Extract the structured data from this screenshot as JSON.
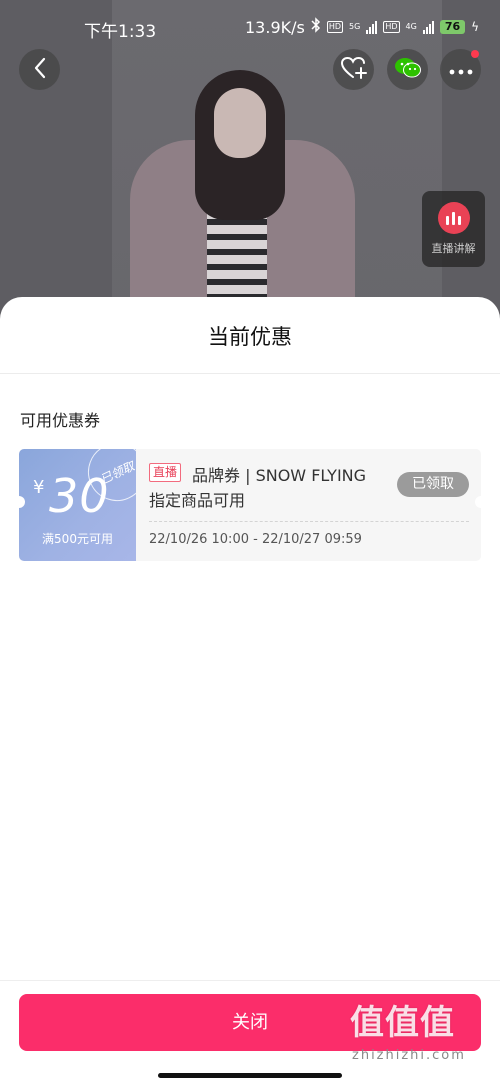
{
  "status_bar": {
    "time": "下午1:33",
    "network_speed": "13.9K/s",
    "sim1_type": "5G",
    "sim2_type": "4G",
    "hd_label": "HD",
    "battery": "76"
  },
  "top_actions": {
    "back_icon": "chevron-left-icon",
    "favorite_icon": "heart-plus-icon",
    "wechat_icon": "wechat-icon",
    "more_icon": "more-dots-icon"
  },
  "live_float": {
    "label": "直播讲解"
  },
  "sheet": {
    "title": "当前优惠",
    "section_label": "可用优惠券",
    "coupons": [
      {
        "currency": "¥",
        "amount": "30",
        "threshold": "满500元可用",
        "stamp": "已领取",
        "tag": "直播",
        "title": "品牌券 | SNOW FLYING",
        "description": "指定商品可用",
        "status_button": "已领取",
        "validity": "22/10/26 10:00 - 22/10/27 09:59"
      }
    ]
  },
  "footer": {
    "close_label": "关闭",
    "watermark": "值值值",
    "watermark_domain": "zhizhizhi.com"
  },
  "colors": {
    "accent": "#fb2d6a",
    "coupon_blue": "#9fb2e4",
    "live_tag": "#e8435b"
  }
}
